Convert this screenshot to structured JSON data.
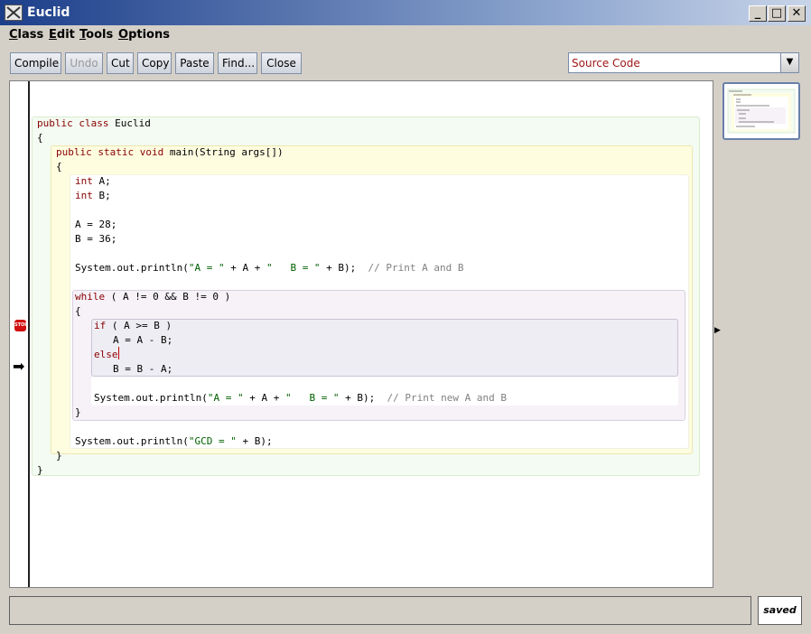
{
  "window": {
    "title": "Euclid"
  },
  "menu": [
    "Class",
    "Edit",
    "Tools",
    "Options"
  ],
  "toolbar": {
    "buttons": [
      "Compile",
      "Undo",
      "Cut",
      "Copy",
      "Paste",
      "Find...",
      "Close"
    ],
    "view_select": "Source Code"
  },
  "code": {
    "l1a": "public class ",
    "l1b": "Euclid",
    "l2": "{",
    "l3a": "public static void ",
    "l3b": "main(String args[])",
    "l4": "{",
    "l5a": "int",
    "l5b": " A;",
    "l6a": "int",
    "l6b": " B;",
    "l7": "A = 28;",
    "l8": "B = 36;",
    "l9a": "System.out.println(",
    "l9b": "\"A = \"",
    "l9c": " + A + ",
    "l9d": "\"   B = \"",
    "l9e": " + B);  ",
    "l9f": "// Print A and B",
    "l10a": "while",
    "l10b": " ( A != 0 && B != 0 )",
    "l11": "{",
    "l12a": "if",
    "l12b": " ( A >= B )",
    "l13": "A = A - B;",
    "l14": "else",
    "l15": "B = B - A;",
    "l16a": "System.out.println(",
    "l16b": "\"A = \"",
    "l16c": " + A + ",
    "l16d": "\"   B = \"",
    "l16e": " + B);  ",
    "l16f": "// Print new A and B",
    "l17": "}",
    "l18a": "System.out.println(",
    "l18b": "\"GCD = \"",
    "l18c": " + B);",
    "l19": "}",
    "l20": "}"
  },
  "breakpoint_label": "STOP",
  "status": {
    "message": "",
    "saved": "saved"
  },
  "colors": {
    "keyword": "#880000",
    "string": "#006000",
    "comment": "#808080"
  }
}
